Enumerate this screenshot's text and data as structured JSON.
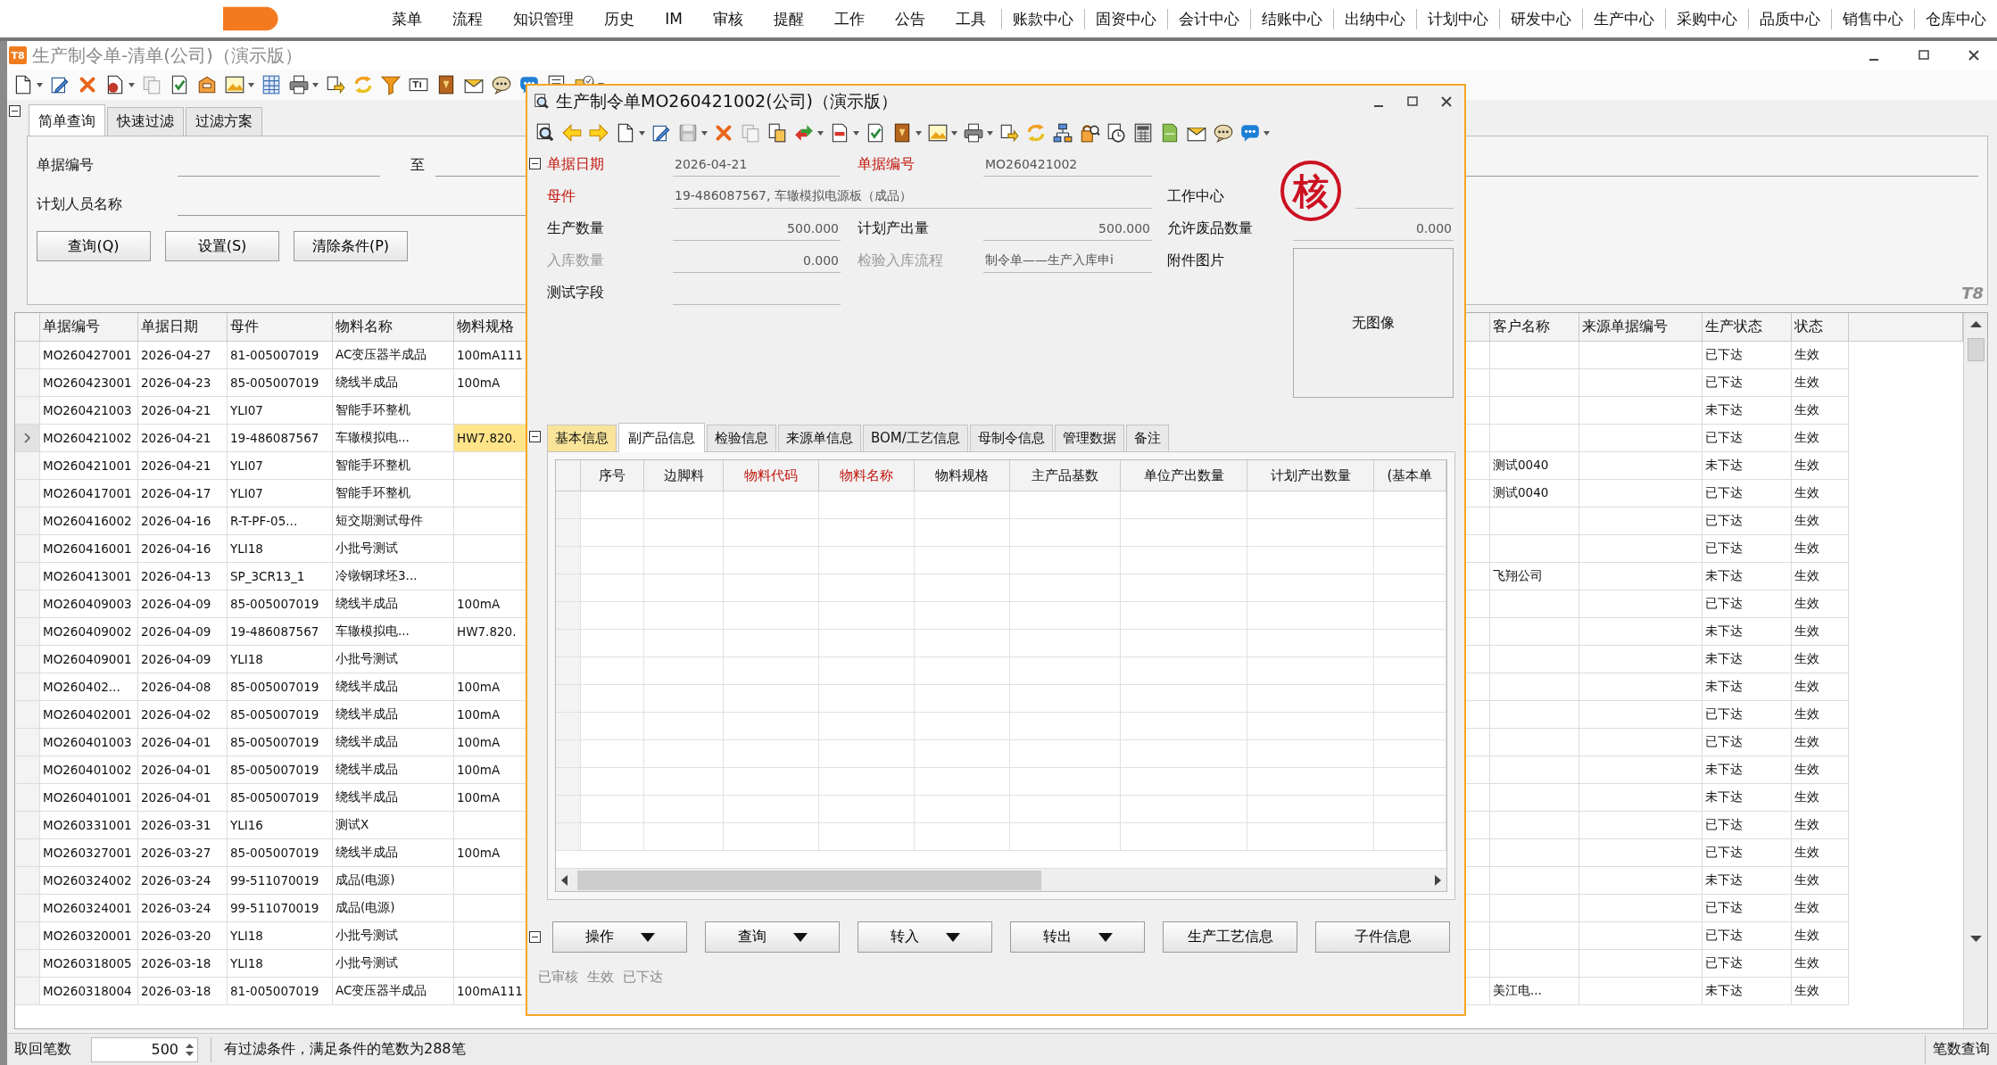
{
  "menubar": {
    "items": [
      "菜单",
      "流程",
      "知识管理",
      "历史",
      "IM",
      "审核",
      "提醒",
      "工作",
      "公告",
      "工具"
    ],
    "centers": [
      "账款中心",
      "固资中心",
      "会计中心",
      "结账中心",
      "出纳中心",
      "计划中心",
      "研发中心",
      "生产中心",
      "采购中心",
      "品质中心",
      "销售中心",
      "仓库中心"
    ]
  },
  "window": {
    "badge": "T8",
    "title": "生产制令单-清单(公司)（演示版）"
  },
  "filter": {
    "tabs": [
      {
        "label": "简单查询",
        "selected": true
      },
      {
        "label": "快速过滤",
        "selected": false
      },
      {
        "label": "过滤方案",
        "selected": false
      }
    ],
    "doc_no_label": "单据编号",
    "to_label": "至",
    "planner_label": "计划人员名称",
    "buttons": [
      "查询(Q)",
      "设置(S)",
      "清除条件(P)"
    ],
    "brand_mark": "T8"
  },
  "list": {
    "columns_left": [
      "单据编号",
      "单据日期",
      "母件",
      "物料名称",
      "物料规格"
    ],
    "columns_right": [
      "客户名称",
      "来源单据编号",
      "生产状态",
      "状态"
    ],
    "rows": [
      {
        "selected": false,
        "doc_no": "MO260427001",
        "date": "2026-04-27",
        "parent": "81-005007019",
        "material_name": "AC变压器半成品",
        "material_spec": "100mA111",
        "production_status": "已下达",
        "status": "生效"
      },
      {
        "selected": false,
        "doc_no": "MO260423001",
        "date": "2026-04-23",
        "parent": "85-005007019",
        "material_name": "绕线半成品",
        "material_spec": "100mA",
        "production_status": "已下达",
        "status": "生效"
      },
      {
        "selected": false,
        "doc_no": "MO260421003",
        "date": "2026-04-21",
        "parent": "YLI07",
        "material_name": "智能手环整机",
        "production_status": "未下达",
        "status": "生效"
      },
      {
        "selected": true,
        "doc_no": "MO260421002",
        "date": "2026-04-21",
        "parent": "19-486087567",
        "material_name": "车辙模拟电...",
        "material_spec": "HW7.820.",
        "production_status": "已下达",
        "status": "生效"
      },
      {
        "selected": false,
        "doc_no": "MO260421001",
        "date": "2026-04-21",
        "parent": "YLI07",
        "material_name": "智能手环整机",
        "customer": "测试0040",
        "production_status": "未下达",
        "status": "生效"
      },
      {
        "selected": false,
        "doc_no": "MO260417001",
        "date": "2026-04-17",
        "parent": "YLI07",
        "material_name": "智能手环整机",
        "customer": "测试0040",
        "production_status": "已下达",
        "status": "生效"
      },
      {
        "selected": false,
        "doc_no": "MO260416002",
        "date": "2026-04-16",
        "parent": "R-T-PF-05...",
        "material_name": "短交期测试母件",
        "production_status": "已下达",
        "status": "生效"
      },
      {
        "selected": false,
        "doc_no": "MO260416001",
        "date": "2026-04-16",
        "parent": "YLI18",
        "material_name": "小批号测试",
        "production_status": "已下达",
        "status": "生效"
      },
      {
        "selected": false,
        "doc_no": "MO260413001",
        "date": "2026-04-13",
        "parent": "SP_3CR13_1",
        "material_name": "冷镦钢球坯3...",
        "customer": "飞翔公司",
        "production_status": "未下达",
        "status": "生效"
      },
      {
        "selected": false,
        "doc_no": "MO260409003",
        "date": "2026-04-09",
        "parent": "85-005007019",
        "material_name": "绕线半成品",
        "material_spec": "100mA",
        "production_status": "已下达",
        "status": "生效"
      },
      {
        "selected": false,
        "doc_no": "MO260409002",
        "date": "2026-04-09",
        "parent": "19-486087567",
        "material_name": "车辙模拟电...",
        "material_spec": "HW7.820.",
        "production_status": "未下达",
        "status": "生效"
      },
      {
        "selected": false,
        "doc_no": "MO260409001",
        "date": "2026-04-09",
        "parent": "YLI18",
        "material_name": "小批号测试",
        "production_status": "未下达",
        "status": "生效"
      },
      {
        "selected": false,
        "doc_no": "MO260402...",
        "date": "2026-04-08",
        "parent": "85-005007019",
        "material_name": "绕线半成品",
        "material_spec": "100mA",
        "production_status": "未下达",
        "status": "生效"
      },
      {
        "selected": false,
        "doc_no": "MO260402001",
        "date": "2026-04-02",
        "parent": "85-005007019",
        "material_name": "绕线半成品",
        "material_spec": "100mA",
        "production_status": "已下达",
        "status": "生效"
      },
      {
        "selected": false,
        "doc_no": "MO260401003",
        "date": "2026-04-01",
        "parent": "85-005007019",
        "material_name": "绕线半成品",
        "material_spec": "100mA",
        "production_status": "已下达",
        "status": "生效"
      },
      {
        "selected": false,
        "doc_no": "MO260401002",
        "date": "2026-04-01",
        "parent": "85-005007019",
        "material_name": "绕线半成品",
        "material_spec": "100mA",
        "production_status": "未下达",
        "status": "生效"
      },
      {
        "selected": false,
        "doc_no": "MO260401001",
        "date": "2026-04-01",
        "parent": "85-005007019",
        "material_name": "绕线半成品",
        "material_spec": "100mA",
        "production_status": "未下达",
        "status": "生效"
      },
      {
        "selected": false,
        "doc_no": "MO260331001",
        "date": "2026-03-31",
        "parent": "YLI16",
        "material_name": "测试X",
        "production_status": "已下达",
        "status": "生效"
      },
      {
        "selected": false,
        "doc_no": "MO260327001",
        "date": "2026-03-27",
        "parent": "85-005007019",
        "material_name": "绕线半成品",
        "material_spec": "100mA",
        "production_status": "已下达",
        "status": "生效"
      },
      {
        "selected": false,
        "doc_no": "MO260324002",
        "date": "2026-03-24",
        "parent": "99-511070019",
        "material_name": "成品(电源)",
        "production_status": "未下达",
        "status": "生效"
      },
      {
        "selected": false,
        "doc_no": "MO260324001",
        "date": "2026-03-24",
        "parent": "99-511070019",
        "material_name": "成品(电源)",
        "production_status": "已下达",
        "status": "生效"
      },
      {
        "selected": false,
        "doc_no": "MO260320001",
        "date": "2026-03-20",
        "parent": "YLI18",
        "material_name": "小批号测试",
        "production_status": "已下达",
        "status": "生效"
      },
      {
        "selected": false,
        "doc_no": "MO260318005",
        "date": "2026-03-18",
        "parent": "YLI18",
        "material_name": "小批号测试",
        "production_status": "已下达",
        "status": "生效"
      },
      {
        "selected": false,
        "doc_no": "MO260318004",
        "date": "2026-03-18",
        "parent": "81-005007019",
        "material_name": "AC变压器半成品",
        "material_spec": "100mA111",
        "customer": "美江电...",
        "production_status": "未下达",
        "status": "生效"
      }
    ]
  },
  "status_bar": {
    "fetch_label": "取回笔数",
    "fetch_count": "500",
    "message": "有过滤条件，满足条件的笔数为288笔",
    "count_query": "笔数查询"
  },
  "dialog": {
    "title": "生产制令单MO260421002(公司)（演示版）",
    "stamp": "核",
    "form_rows": [
      [
        {
          "label": "单据日期",
          "value": "2026-04-21",
          "kind": "text",
          "required": true,
          "disabled": false
        },
        {
          "label": "单据编号",
          "value": "MO260421002",
          "kind": "text",
          "required": true,
          "disabled": false
        }
      ],
      [
        {
          "label": "母件",
          "value": "19-486087567, 车辙模拟电源板（成品）",
          "kind": "wide",
          "required": true,
          "disabled": false
        },
        {
          "label": "工作中心",
          "kind": "text",
          "required": false,
          "disabled": false
        }
      ],
      [
        {
          "label": "生产数量",
          "value": "500.000",
          "kind": "number",
          "required": false,
          "disabled": false
        },
        {
          "label": "计划产出量",
          "value": "500.000",
          "kind": "number",
          "required": false,
          "disabled": false
        },
        {
          "label": "允许废品数量",
          "value": "0.000",
          "kind": "number",
          "required": false,
          "disabled": false
        }
      ],
      [
        {
          "label": "入库数量",
          "value": "0.000",
          "kind": "number",
          "required": false,
          "disabled": true
        },
        {
          "label": "检验入库流程",
          "value": "制令单——生产入库申i",
          "kind": "text",
          "required": false,
          "disabled": true
        },
        {
          "label": "附件图片",
          "value": "无图像",
          "kind": "image",
          "required": false,
          "disabled": false
        }
      ],
      [
        {
          "label": "测试字段",
          "kind": "text",
          "required": false,
          "disabled": false
        }
      ]
    ],
    "tabs": [
      {
        "label": "基本信息",
        "selected": false,
        "highlighted": true
      },
      {
        "label": "副产品信息",
        "selected": true,
        "highlighted": false
      },
      {
        "label": "检验信息",
        "selected": false,
        "highlighted": false
      },
      {
        "label": "来源单信息",
        "selected": false,
        "highlighted": false
      },
      {
        "label": "BOM/工艺信息",
        "selected": false,
        "highlighted": false
      },
      {
        "label": "母制令信息",
        "selected": false,
        "highlighted": false
      },
      {
        "label": "管理数据",
        "selected": false,
        "highlighted": false
      },
      {
        "label": "备注",
        "selected": false,
        "highlighted": false
      }
    ],
    "columns": [
      {
        "label": "序号",
        "required": false
      },
      {
        "label": "边脚料",
        "required": false
      },
      {
        "label": "物料代码",
        "required": true
      },
      {
        "label": "物料名称",
        "required": true
      },
      {
        "label": "物料规格",
        "required": false
      },
      {
        "label": "主产品基数",
        "required": false
      },
      {
        "label": "单位产出数量",
        "required": false
      },
      {
        "label": "计划产出数量",
        "required": false
      },
      {
        "label": "(基本单",
        "required": false
      }
    ],
    "buttons": [
      {
        "label": "操作",
        "dropdown": true
      },
      {
        "label": "查询",
        "dropdown": true
      },
      {
        "label": "转入",
        "dropdown": true
      },
      {
        "label": "转出",
        "dropdown": true
      },
      {
        "label": "生产工艺信息",
        "dropdown": false
      },
      {
        "label": "子件信息",
        "dropdown": false
      }
    ],
    "flags": [
      "已审核",
      "生效",
      "已下达"
    ]
  }
}
